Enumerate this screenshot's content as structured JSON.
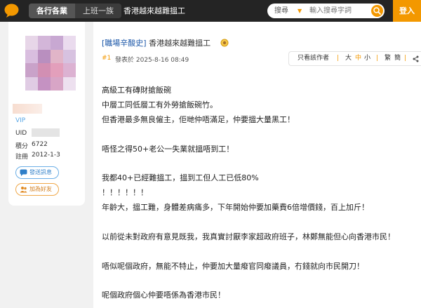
{
  "topbar": {
    "tabs": [
      {
        "label": "各行各業",
        "active": true
      },
      {
        "label": "上班一族",
        "active": false
      }
    ],
    "current_forum": "香港越來越難搵工",
    "search": {
      "type_label": "搜尋",
      "placeholder": "輸入搜尋字詞"
    },
    "login_label": "登入"
  },
  "profile": {
    "level": "VIP",
    "uid_label": "UID",
    "points_label": "積分",
    "points_value": "6722",
    "register_label": "註冊",
    "register_value": "2012-1-3",
    "send_message_label": "發送訊息",
    "add_friend_label": "加為好友"
  },
  "post": {
    "category": "[職場辛酸史]",
    "title": "香港越來越難搵工",
    "floor": "#1",
    "posted_at": "發表於 2025-8-16 08:49",
    "tools": {
      "author_only": "只看該作者",
      "size_large": "大",
      "size_medium": "中",
      "size_small": "小",
      "traditional": "繁",
      "simplified": "簡"
    },
    "lines": [
      "高級工有磚財搶飯碗",
      "中層工同低層工有外勞搶飯碗竹。",
      "但香港最多無良僱主，佢哋仲唔滿足，仲要搵大量黑工！",
      "唔怪之得50+老公一失業就搵唔到工！",
      "我都40+已經難搵工，搵到工但人工已低80%",
      "！！！！！！",
      "年齡大，搵工難，身體差病痛多，下年開始仲要加藥費6倍增價錢，百上加斤！",
      "以前從未對政府有意見既我，我真實討厭李家超政府班子，林鄭無能但心向香港市民！",
      "唔似呢個政府，無能不特止，仲要加大量癈官同癈議員，冇錢就向市民開刀！",
      "呢個政府個心仲要唔係為香港市民！"
    ]
  },
  "colors": {
    "accent": "#f39800",
    "topbar": "#242424",
    "category_link": "#1a56a8",
    "vip": "#5aa8e6"
  }
}
